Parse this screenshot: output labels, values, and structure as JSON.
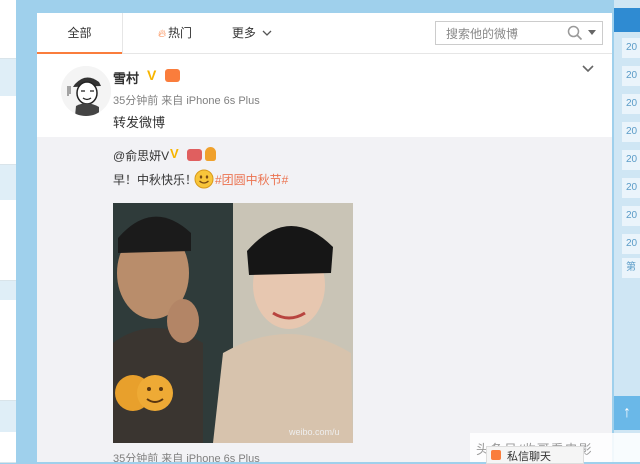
{
  "tabs": {
    "all": "全部",
    "hot": "热门",
    "more": "更多"
  },
  "search": {
    "placeholder": "搜索他的微博"
  },
  "post": {
    "author": "雪村",
    "verified_mark": "V",
    "meta": "35分钟前 来自 iPhone 6s Plus",
    "text": "转发微博"
  },
  "repost": {
    "author": "@俞思妍V",
    "verified_mark": "V",
    "text": "早！中秋快乐！",
    "hashtag": "#团圆中秋节#",
    "meta": "35分钟前 来自 iPhone 6s Plus",
    "photo_watermark": "weibo.com/u"
  },
  "right_rail": {
    "items": [
      "20",
      "20",
      "20",
      "20",
      "20",
      "20",
      "20",
      "20"
    ],
    "last": "第"
  },
  "overlay": {
    "watermark": "头条号/收哥看电影",
    "chat_label": "私信聊天"
  },
  "icons": {
    "flame": "fire-icon",
    "search": "search-icon",
    "dropdown": "chevron-down-icon",
    "back_to_top": "arrow-up-icon"
  },
  "colors": {
    "accent": "#fa7d3c",
    "hashtag": "#eb7350",
    "verified": "#f7b500",
    "background": "#9fd0ec"
  }
}
